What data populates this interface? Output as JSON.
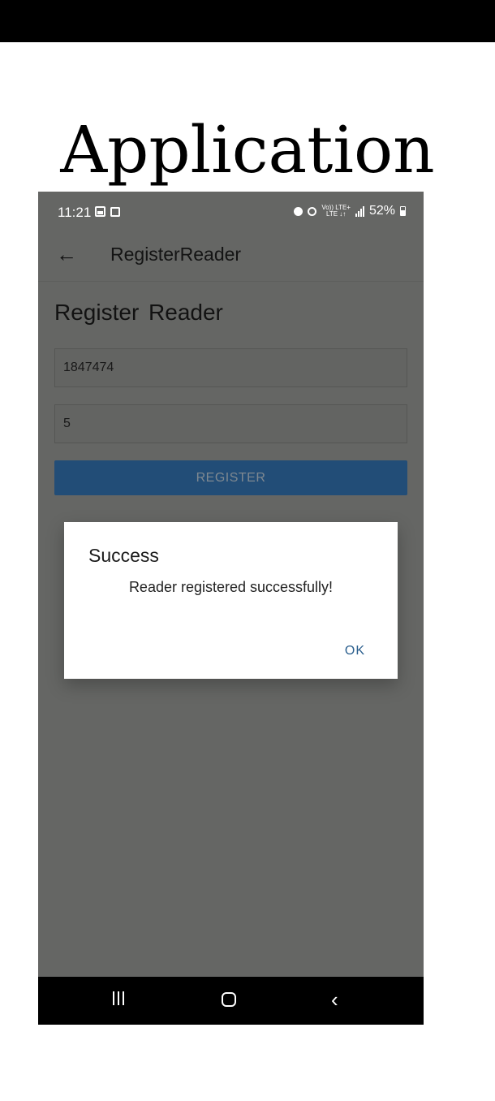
{
  "slide": {
    "title": "Application"
  },
  "status_bar": {
    "time": "11:21",
    "network_top": "Vo)) LTE+",
    "network_bottom": "LTE ↓↑",
    "battery_percent": "52%"
  },
  "app_bar": {
    "back_icon": "←",
    "title": "RegisterReader"
  },
  "form": {
    "heading": "Register Reader",
    "field1_value": "1847474",
    "field2_value": "5",
    "register_label": "REGISTER"
  },
  "dialog": {
    "title": "Success",
    "message": "Reader registered successfully!",
    "ok_label": "OK"
  },
  "nav_bar": {
    "back_icon": "‹"
  },
  "colors": {
    "overlay_background": "#656664",
    "register_button": "#224d77",
    "dialog_button_text": "#2b5f8e"
  }
}
